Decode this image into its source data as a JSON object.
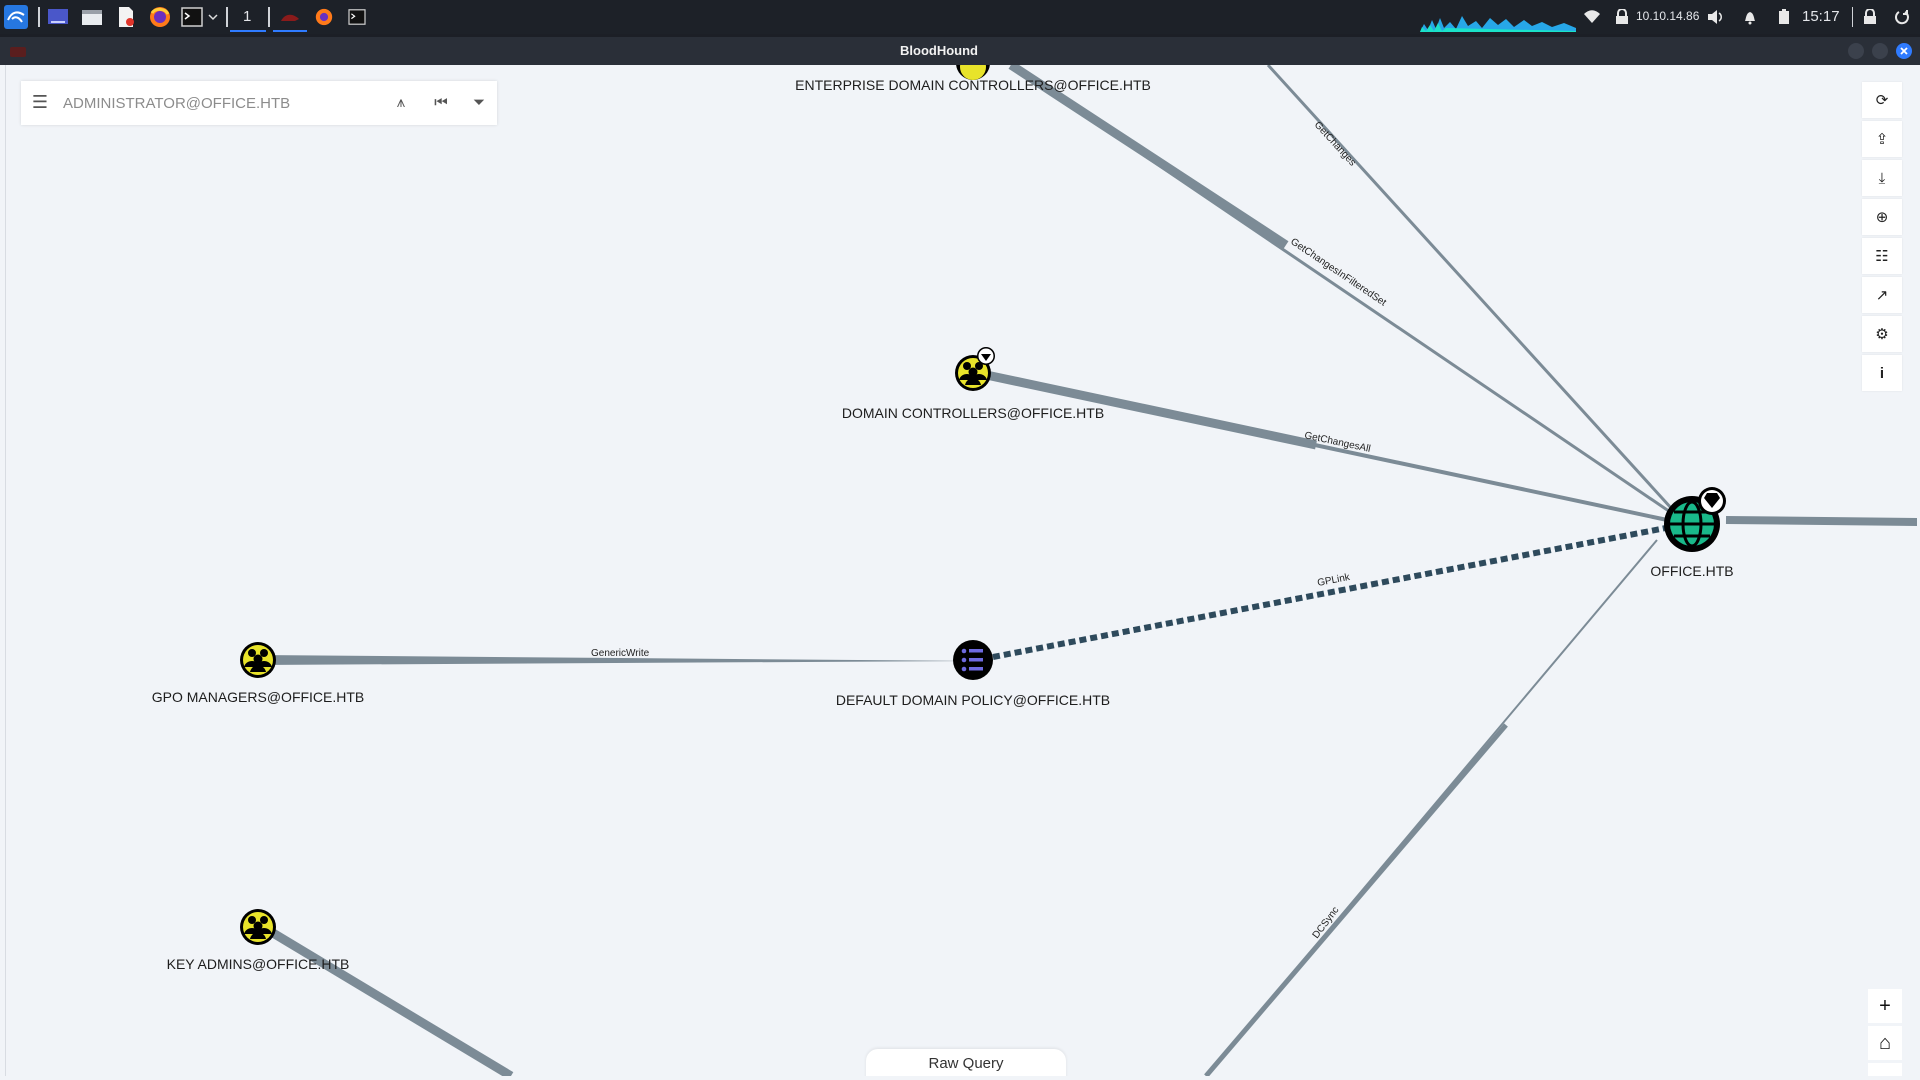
{
  "taskbar": {
    "workspace": "1",
    "ip": "10.10.14.86",
    "clock": "15:17",
    "icons": [
      "kali-menu-icon",
      "desktop-icon",
      "file-manager-icon",
      "text-editor-icon",
      "firefox-icon",
      "terminal-icon",
      "bloodhound-icon"
    ]
  },
  "window": {
    "title": "BloodHound"
  },
  "search": {
    "placeholder": "ADMINISTRATOR@OFFICE.HTB",
    "menu_glyph": "☰",
    "path_glyph": "⩚",
    "back_glyph": "⏮",
    "filter_glyph": "⏷"
  },
  "right_toolbar": [
    {
      "name": "refresh-icon",
      "glyph": "⟳"
    },
    {
      "name": "export-icon",
      "glyph": "⇪"
    },
    {
      "name": "import-icon",
      "glyph": "⤓"
    },
    {
      "name": "upload-icon",
      "glyph": "⊕"
    },
    {
      "name": "queries-icon",
      "glyph": "☷"
    },
    {
      "name": "stats-icon",
      "glyph": "↗"
    },
    {
      "name": "settings-icon",
      "glyph": "⚙"
    },
    {
      "name": "info-icon",
      "glyph": "i"
    }
  ],
  "zoom": {
    "in": "+",
    "home": "⌂",
    "out": "−"
  },
  "raw_query": {
    "label": "Raw Query"
  },
  "graph": {
    "nodes": [
      {
        "id": "enterprise-dc",
        "label": "ENTERPRISE DOMAIN CONTROLLERS@OFFICE.HTB",
        "type": "group"
      },
      {
        "id": "domain-controllers",
        "label": "DOMAIN CONTROLLERS@OFFICE.HTB",
        "type": "group",
        "highvalue": true
      },
      {
        "id": "office-htb",
        "label": "OFFICE.HTB",
        "type": "domain",
        "highvalue": true
      },
      {
        "id": "gpo-managers",
        "label": "GPO MANAGERS@OFFICE.HTB",
        "type": "group"
      },
      {
        "id": "default-domain-policy",
        "label": "DEFAULT DOMAIN POLICY@OFFICE.HTB",
        "type": "gpo"
      },
      {
        "id": "key-admins",
        "label": "KEY ADMINS@OFFICE.HTB",
        "type": "group"
      }
    ],
    "edges": [
      {
        "label": "GetChanges"
      },
      {
        "label": "GetChangesInFilteredSet"
      },
      {
        "label": "GetChangesAll"
      },
      {
        "label": "GPLink"
      },
      {
        "label": "GenericWrite"
      },
      {
        "label": "DCSync"
      }
    ]
  },
  "colors": {
    "edge": "#7c8b96",
    "gplink": "#2e4a5c",
    "group_node": "#e8e32a",
    "domain_node": "#19b98a",
    "gpo_node": "#6e6ae0"
  }
}
